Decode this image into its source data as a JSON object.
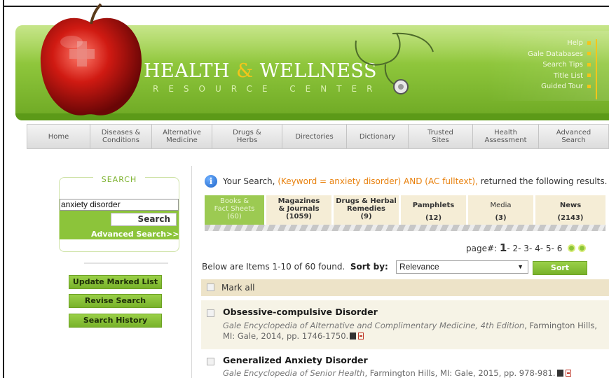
{
  "header": {
    "brand_title_a": "HEALTH",
    "brand_amp": "&",
    "brand_title_b": "WELLNESS",
    "brand_subtitle": "RESOURCE CENTER",
    "help_links": [
      "Help",
      "Gale Databases",
      "Search Tips",
      "Title List",
      "Guided Tour"
    ]
  },
  "nav": {
    "items": [
      {
        "label": "Home"
      },
      {
        "label": "Diseases &\nConditions"
      },
      {
        "label": "Alternative\nMedicine"
      },
      {
        "label": "Drugs &\nHerbs"
      },
      {
        "label": "Directories"
      },
      {
        "label": "Dictionary"
      },
      {
        "label": "Trusted\nSites"
      },
      {
        "label": "Health\nAssessment"
      },
      {
        "label": "Advanced\nSearch"
      }
    ]
  },
  "search": {
    "legend": "SEARCH",
    "query": "anxiety disorder",
    "button": "Search",
    "advanced_link": "Advanced Search>>"
  },
  "sidebar_buttons": [
    "Update Marked List",
    "Revise Search",
    "Search History"
  ],
  "results": {
    "summary_prefix": "Your Search,",
    "summary_query": "(Keyword = anxiety disorder) AND (AC fulltext),",
    "summary_suffix": "returned the following results.",
    "tabs": [
      {
        "label": "Books &\nFact Sheets",
        "count": "(60)",
        "active": true
      },
      {
        "label": "Magazines\n& Journals",
        "count": "(1059)",
        "active": false
      },
      {
        "label": "Drugs & Herbal\nRemedies",
        "count": "(9)",
        "active": false
      },
      {
        "label": "Pamphlets",
        "count": "(12)",
        "active": false
      },
      {
        "label": "Media",
        "count": "(3)",
        "active": false
      },
      {
        "label": "News",
        "count": "(2143)",
        "active": false
      }
    ],
    "pager": {
      "label": "page#:",
      "current": "1",
      "pages": [
        "2",
        "3",
        "4",
        "5",
        "6"
      ]
    },
    "items_label": "Below are Items 1-10 of 60 found.",
    "sort_label": "Sort by:",
    "sort_value": "Relevance",
    "sort_button": "Sort",
    "mark_all": "Mark all",
    "list": [
      {
        "title": "Obsessive-compulsive Disorder",
        "source": "Gale Encyclopedia of Alternative and Complimentary Medicine, 4th Edition",
        "details": ", Farmington Hills, MI: Gale, 2014, pp. 1746-1750."
      },
      {
        "title": "Generalized Anxiety Disorder",
        "source": "Gale Encyclopedia of Senior Health",
        "details": ", Farmington Hills, MI: Gale, 2015, pp. 978-981."
      }
    ]
  },
  "colors": {
    "brand_green": "#8cc43a",
    "accent_yellow": "#f5c51a",
    "query_orange": "#e8800c",
    "tab_beige": "#f5edd6"
  }
}
